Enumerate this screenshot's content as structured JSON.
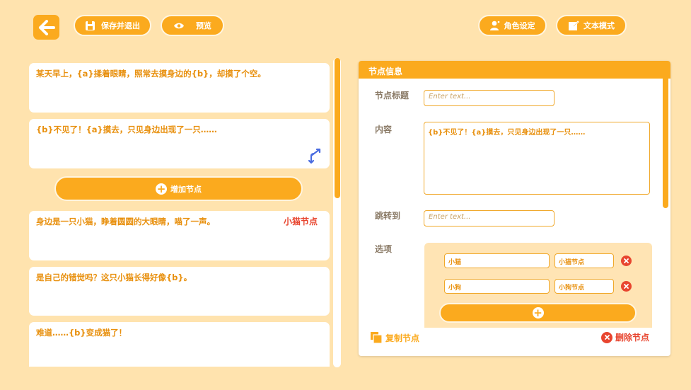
{
  "toolbar": {
    "save_exit_label": "保存并退出",
    "preview_label": "预览",
    "character_label": "角色设定",
    "text_mode_label": "文本模式"
  },
  "nodes": [
    {
      "text": "某天早上，{a}揉着眼睛，照常去摸身边的{b}，却摸了个空。",
      "tag": ""
    },
    {
      "text": "{b}不见了！{a}摸去，只见身边出现了一只……",
      "tag": ""
    },
    {
      "text": "身边是一只小猫，睁着圆圆的大眼睛，喵了一声。",
      "tag": "小猫节点"
    },
    {
      "text": "是自己的错觉吗？这只小猫长得好像{b}。",
      "tag": ""
    },
    {
      "text": "难道……{b}变成猫了！",
      "tag": ""
    }
  ],
  "add_node_label": "增加节点",
  "panel": {
    "title": "节点信息",
    "node_title_label": "节点标题",
    "node_title_placeholder": "Enter text...",
    "content_label": "内容",
    "content_value": "{b}不见了！{a}摸去，只见身边出现了一只……",
    "jump_label": "跳转到",
    "jump_placeholder": "Enter text...",
    "options_label": "选项",
    "options": [
      {
        "text": "小猫",
        "target": "小猫节点"
      },
      {
        "text": "小狗",
        "target": "小狗节点"
      }
    ],
    "copy_label": "复制节点",
    "delete_label": "删除节点"
  },
  "colors": {
    "background": "#FFE3AE",
    "accent": "#FBAA1E",
    "text": "#E8900E",
    "danger": "#E8452F"
  }
}
